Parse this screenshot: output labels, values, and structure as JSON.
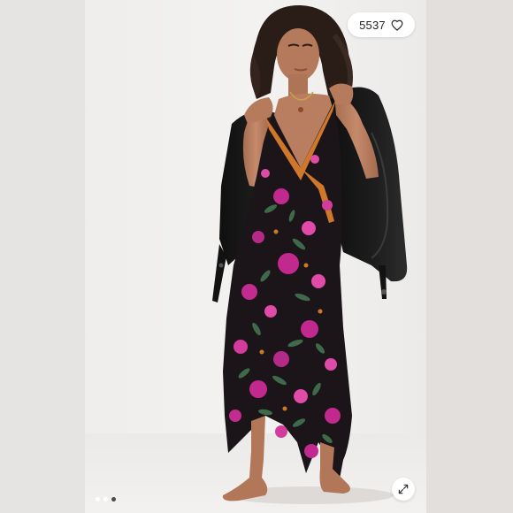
{
  "likes": {
    "count": "5537",
    "icon": "heart-outline-icon"
  },
  "carousel": {
    "total": 3,
    "active_index": 2
  },
  "expand": {
    "icon": "expand-arrows-icon"
  },
  "colors": {
    "backdrop": "#efeeed",
    "dress_base": "#1b1519",
    "flower_magenta": "#c2298e",
    "flower_pink": "#e04aa8",
    "leaf_green": "#3f6a4a",
    "trim_orange": "#d0782a",
    "jacket": "#151515",
    "skin": "#b77d5f"
  }
}
